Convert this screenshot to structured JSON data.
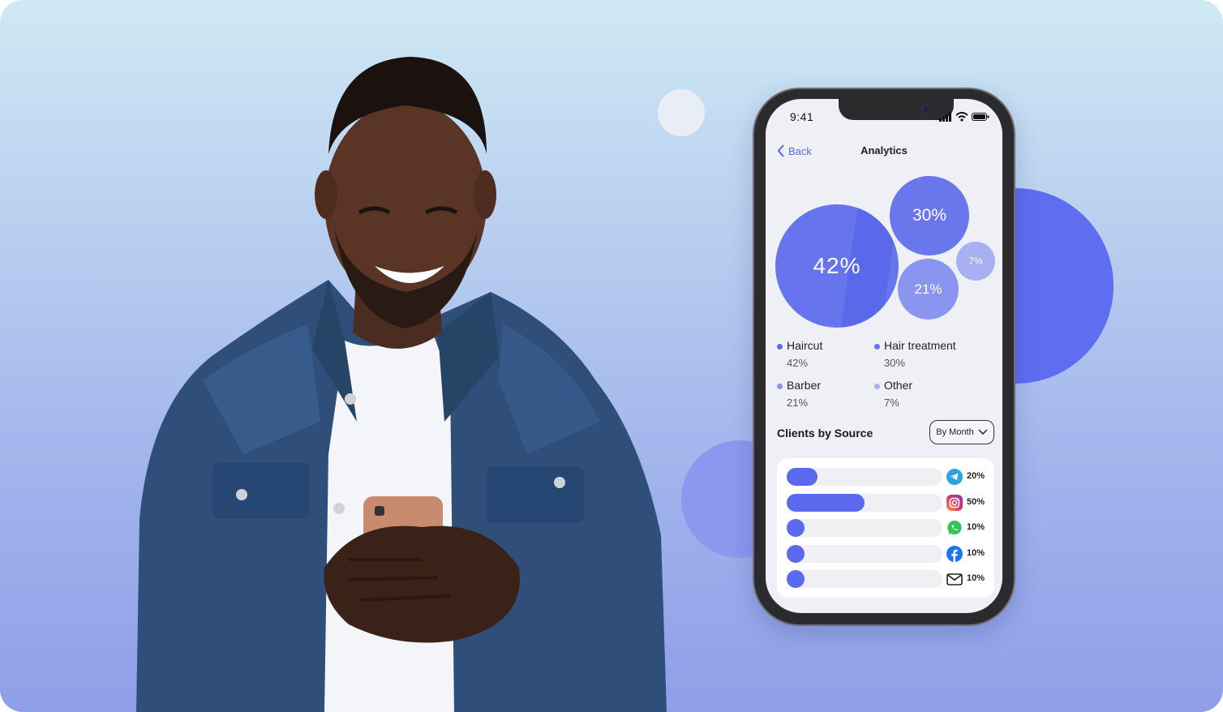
{
  "colors": {
    "accent": "#5b69ee",
    "background_top": "#cfe9f4",
    "background_bottom": "#8e9fe8"
  },
  "phone": {
    "status_time": "9:41",
    "nav": {
      "back_label": "Back",
      "title": "Analytics"
    },
    "bubbles": [
      {
        "label": "42%",
        "value": 42
      },
      {
        "label": "30%",
        "value": 30
      },
      {
        "label": "21%",
        "value": 21
      },
      {
        "label": "7%",
        "value": 7
      }
    ],
    "legend": [
      {
        "name": "Haircut",
        "pct": "42%",
        "color": "#5b69ee"
      },
      {
        "name": "Hair treatment",
        "pct": "30%",
        "color": "#6a76ec"
      },
      {
        "name": "Barber",
        "pct": "21%",
        "color": "#8a95f0"
      },
      {
        "name": "Other",
        "pct": "7%",
        "color": "#a8b0f3"
      }
    ],
    "section_title": "Clients by Source",
    "filter_label": "By Month",
    "sources": [
      {
        "icon": "telegram-icon",
        "pct_label": "20%",
        "value": 0.2
      },
      {
        "icon": "instagram-icon",
        "pct_label": "50%",
        "value": 0.5
      },
      {
        "icon": "whatsapp-icon",
        "pct_label": "10%",
        "value": 0.1
      },
      {
        "icon": "facebook-icon",
        "pct_label": "10%",
        "value": 0.1
      },
      {
        "icon": "mail-icon",
        "pct_label": "10%",
        "value": 0.1
      }
    ]
  }
}
